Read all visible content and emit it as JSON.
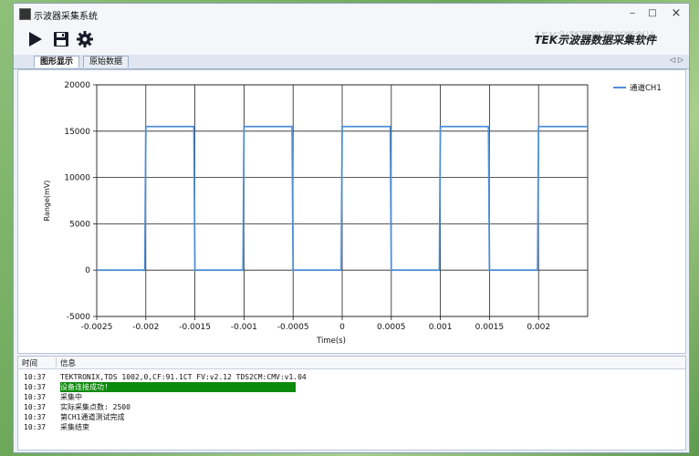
{
  "window": {
    "title": "示波器采集系统",
    "brand": "TEK示波器数据采集软件"
  },
  "titlebar_buttons": {
    "minimize": "‒",
    "maximize": "□",
    "close": "×"
  },
  "toolbar": {
    "play_icon": "play-icon",
    "save_icon": "save-icon",
    "settings_icon": "gear-icon"
  },
  "tabs": [
    {
      "label": "图形显示",
      "active": true
    },
    {
      "label": "原始数据",
      "active": false
    }
  ],
  "tab_scroll": "◁ ▷",
  "chart_data": {
    "type": "line",
    "xlabel": "Time(s)",
    "ylabel": "Range(mV)",
    "xlim": [
      -0.0025,
      0.0025
    ],
    "ylim": [
      -5000,
      20000
    ],
    "x_ticks": [
      "-0.0025",
      "-0.002",
      "-0.0015",
      "-0.001",
      "-0.0005",
      "0",
      "0.0005",
      "0.001",
      "0.0015",
      "0.002"
    ],
    "x_tick_values": [
      -0.0025,
      -0.002,
      -0.0015,
      -0.001,
      -0.0005,
      0,
      0.0005,
      0.001,
      0.0015,
      0.002
    ],
    "y_ticks": [
      "20000",
      "15000",
      "10000",
      "5000",
      "0",
      "-5000"
    ],
    "y_tick_values": [
      20000,
      15000,
      10000,
      5000,
      0,
      -5000
    ],
    "grid": true,
    "legend_position": "top-right",
    "series": [
      {
        "name": "通道CH1",
        "color": "#4f8fd6",
        "x": [
          -0.0025,
          -0.00201,
          -0.002,
          -0.00151,
          -0.0015,
          -0.00101,
          -0.001,
          -0.00051,
          -0.0005,
          -1e-05,
          0,
          0.00049,
          0.0005,
          0.00099,
          0.001,
          0.00149,
          0.0015,
          0.00199,
          0.002,
          0.0025
        ],
        "y": [
          0,
          0,
          15500,
          15500,
          0,
          0,
          15500,
          15500,
          0,
          0,
          15500,
          15500,
          0,
          0,
          15500,
          15500,
          0,
          0,
          15500,
          15500
        ]
      }
    ]
  },
  "log": {
    "headers": {
      "time": "时间",
      "message": "信息"
    },
    "rows": [
      {
        "time": "10:37",
        "message": "TEKTRONIX,TDS 1002,0,CF:91.1CT FV:v2.12 TDS2CM:CMV:v1.04",
        "highlight": false
      },
      {
        "time": "10:37",
        "message": "设备连接成功!",
        "highlight": true
      },
      {
        "time": "10:37",
        "message": "采集中",
        "highlight": false
      },
      {
        "time": "10:37",
        "message": "实际采集点数: 2500",
        "highlight": false
      },
      {
        "time": "10:37",
        "message": "第CH1通道测试完成",
        "highlight": false
      },
      {
        "time": "10:37",
        "message": "采集结束",
        "highlight": false
      }
    ]
  }
}
